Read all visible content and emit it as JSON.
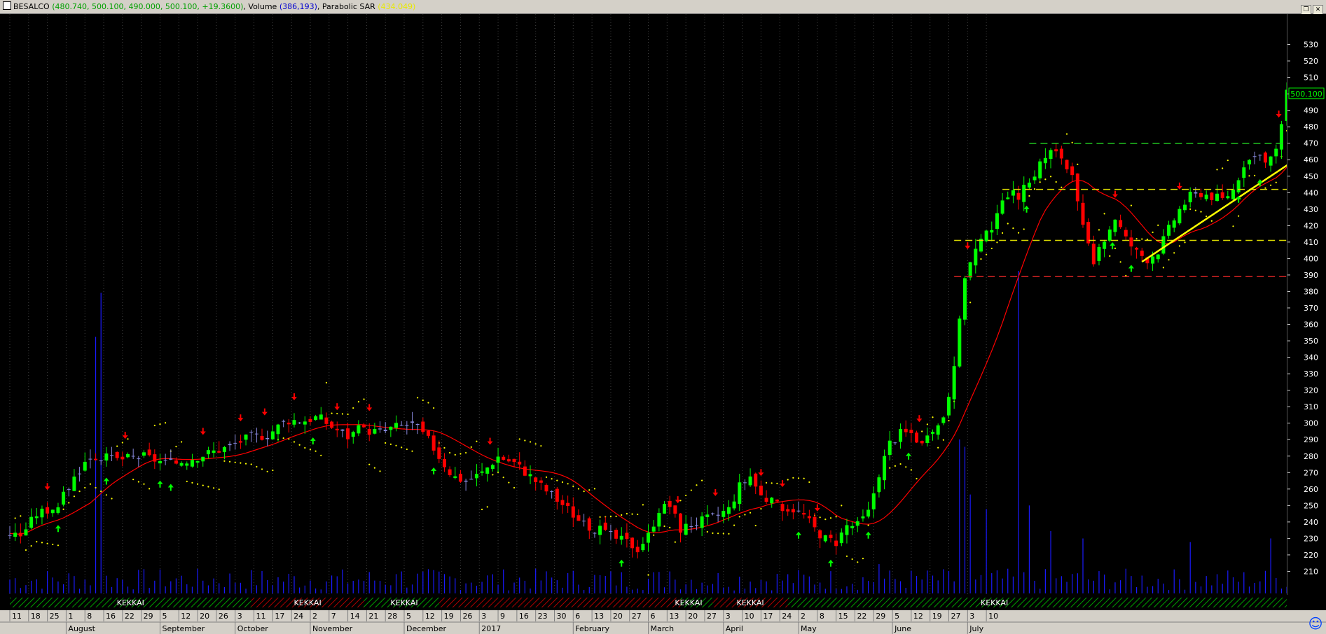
{
  "titlebar": {
    "symbol": "BESALCO",
    "ohlc": "(480.740, 500.100, 490.000, 500.100, +19.3600)",
    "volume_label": "Volume",
    "volume_value": "(386,193)",
    "sar_label": "Parabolic SAR",
    "sar_value": "(434.049)"
  },
  "price_tag": "500.100",
  "colors": {
    "background": "#000000",
    "up_candle": "#00ff00",
    "down_candle": "#ff0000",
    "doji_candle": "#8888dd",
    "ma_line": "#ff0000",
    "sar_dots": "#ffff00",
    "volume": "#1a1aff",
    "trendline": "#ffff00",
    "grid": "#404040"
  },
  "chart_data": {
    "type": "candlestick",
    "ylim": [
      200,
      540
    ],
    "yticks": [
      210,
      220,
      230,
      240,
      250,
      260,
      270,
      280,
      290,
      300,
      310,
      320,
      330,
      340,
      350,
      360,
      370,
      380,
      390,
      400,
      410,
      420,
      430,
      440,
      450,
      460,
      470,
      480,
      490,
      500,
      510,
      520,
      530
    ],
    "price_anchors": [
      [
        0,
        233
      ],
      [
        4,
        232
      ],
      [
        10,
        245
      ],
      [
        18,
        250
      ],
      [
        25,
        270
      ],
      [
        30,
        280
      ],
      [
        40,
        278
      ],
      [
        50,
        280
      ],
      [
        60,
        275
      ],
      [
        70,
        280
      ],
      [
        80,
        285
      ],
      [
        90,
        292
      ],
      [
        96,
        293
      ],
      [
        103,
        302
      ],
      [
        110,
        302
      ],
      [
        115,
        304
      ],
      [
        120,
        298
      ],
      [
        126,
        292
      ],
      [
        130,
        296
      ],
      [
        138,
        295
      ],
      [
        144,
        298
      ],
      [
        150,
        300
      ],
      [
        156,
        290
      ],
      [
        160,
        280
      ],
      [
        165,
        268
      ],
      [
        170,
        265
      ],
      [
        176,
        270
      ],
      [
        182,
        280
      ],
      [
        188,
        276
      ],
      [
        194,
        268
      ],
      [
        198,
        262
      ],
      [
        203,
        255
      ],
      [
        208,
        248
      ],
      [
        214,
        238
      ],
      [
        220,
        235
      ],
      [
        226,
        230
      ],
      [
        230,
        228
      ],
      [
        234,
        224
      ],
      [
        238,
        232
      ],
      [
        242,
        248
      ],
      [
        246,
        250
      ],
      [
        250,
        236
      ],
      [
        256,
        240
      ],
      [
        262,
        243
      ],
      [
        268,
        248
      ],
      [
        272,
        262
      ],
      [
        276,
        268
      ],
      [
        280,
        256
      ],
      [
        286,
        250
      ],
      [
        292,
        248
      ],
      [
        296,
        244
      ],
      [
        300,
        236
      ],
      [
        304,
        230
      ],
      [
        308,
        228
      ],
      [
        312,
        238
      ],
      [
        316,
        238
      ],
      [
        320,
        246
      ],
      [
        324,
        270
      ],
      [
        328,
        288
      ],
      [
        332,
        294
      ],
      [
        336,
        294
      ],
      [
        340,
        287
      ],
      [
        344,
        292
      ],
      [
        348,
        305
      ],
      [
        352,
        332
      ],
      [
        356,
        390
      ],
      [
        360,
        405
      ],
      [
        364,
        414
      ],
      [
        368,
        425
      ],
      [
        372,
        440
      ],
      [
        376,
        438
      ],
      [
        380,
        446
      ],
      [
        384,
        458
      ],
      [
        388,
        465
      ],
      [
        392,
        462
      ],
      [
        396,
        448
      ],
      [
        400,
        418
      ],
      [
        404,
        396
      ],
      [
        408,
        412
      ],
      [
        412,
        425
      ],
      [
        416,
        412
      ],
      [
        420,
        404
      ],
      [
        424,
        400
      ],
      [
        428,
        405
      ],
      [
        432,
        418
      ],
      [
        436,
        430
      ],
      [
        440,
        438
      ],
      [
        444,
        440
      ],
      [
        448,
        438
      ],
      [
        452,
        436
      ],
      [
        456,
        442
      ],
      [
        460,
        458
      ],
      [
        464,
        462
      ],
      [
        468,
        458
      ],
      [
        472,
        465
      ],
      [
        476,
        500
      ]
    ],
    "volume": {
      "ylim": [
        0,
        420
      ],
      "spikes": [
        [
          32,
          350
        ],
        [
          34,
          410
        ],
        [
          123,
          50
        ],
        [
          146,
          30
        ],
        [
          161,
          24
        ],
        [
          179,
          22
        ],
        [
          246,
          30
        ],
        [
          287,
          26
        ],
        [
          324,
          40
        ],
        [
          354,
          210
        ],
        [
          356,
          200
        ],
        [
          358,
          135
        ],
        [
          364,
          115
        ],
        [
          376,
          440
        ],
        [
          380,
          120
        ],
        [
          388,
          85
        ],
        [
          400,
          75
        ],
        [
          440,
          70
        ],
        [
          470,
          75
        ]
      ]
    },
    "trendline": {
      "x": [
        422,
        493
      ],
      "y": [
        398,
        475
      ]
    },
    "levels": [
      {
        "y": 470,
        "x": [
          380,
          480
        ],
        "color": "#22cc22"
      },
      {
        "y": 442,
        "x": [
          370,
          480
        ],
        "color": "#dddd00"
      },
      {
        "y": 411,
        "x": [
          352,
          480
        ],
        "color": "#dddd00"
      },
      {
        "y": 389,
        "x": [
          352,
          480
        ],
        "color": "#cc2222"
      }
    ],
    "buy_arrows": [
      18,
      36,
      56,
      60,
      113,
      158,
      228,
      294,
      306,
      320,
      335,
      379,
      411,
      418,
      458,
      466
    ],
    "sell_arrows": [
      14,
      43,
      72,
      86,
      95,
      106,
      122,
      134,
      179,
      249,
      263,
      280,
      288,
      301,
      339,
      357,
      412,
      436,
      473
    ],
    "x_labels": [
      {
        "d": 0,
        "t": "11"
      },
      {
        "d": 7,
        "t": "18"
      },
      {
        "d": 14,
        "t": "25"
      },
      {
        "d": 21,
        "t": "1"
      },
      {
        "d": 28,
        "t": "8"
      },
      {
        "d": 35,
        "t": "16"
      },
      {
        "d": 42,
        "t": "22"
      },
      {
        "d": 49,
        "t": "29"
      },
      {
        "d": 56,
        "t": "5"
      },
      {
        "d": 63,
        "t": "12"
      },
      {
        "d": 70,
        "t": "20"
      },
      {
        "d": 77,
        "t": "26"
      },
      {
        "d": 84,
        "t": "3"
      },
      {
        "d": 91,
        "t": "11"
      },
      {
        "d": 98,
        "t": "17"
      },
      {
        "d": 105,
        "t": "24"
      },
      {
        "d": 112,
        "t": "2"
      },
      {
        "d": 119,
        "t": "7"
      },
      {
        "d": 126,
        "t": "14"
      },
      {
        "d": 133,
        "t": "21"
      },
      {
        "d": 140,
        "t": "28"
      },
      {
        "d": 147,
        "t": "5"
      },
      {
        "d": 154,
        "t": "12"
      },
      {
        "d": 161,
        "t": "19"
      },
      {
        "d": 168,
        "t": "26"
      },
      {
        "d": 175,
        "t": "3"
      },
      {
        "d": 182,
        "t": "9"
      },
      {
        "d": 189,
        "t": "16"
      },
      {
        "d": 196,
        "t": "23"
      },
      {
        "d": 203,
        "t": "30"
      },
      {
        "d": 210,
        "t": "6"
      },
      {
        "d": 217,
        "t": "13"
      },
      {
        "d": 224,
        "t": "20"
      },
      {
        "d": 231,
        "t": "27"
      },
      {
        "d": 238,
        "t": "6"
      },
      {
        "d": 245,
        "t": "13"
      },
      {
        "d": 252,
        "t": "20"
      },
      {
        "d": 259,
        "t": "27"
      },
      {
        "d": 266,
        "t": "3"
      },
      {
        "d": 273,
        "t": "10"
      },
      {
        "d": 280,
        "t": "17"
      },
      {
        "d": 287,
        "t": "24"
      },
      {
        "d": 294,
        "t": "2"
      },
      {
        "d": 301,
        "t": "8"
      },
      {
        "d": 308,
        "t": "15"
      },
      {
        "d": 315,
        "t": "22"
      },
      {
        "d": 322,
        "t": "29"
      },
      {
        "d": 329,
        "t": "5"
      },
      {
        "d": 336,
        "t": "12"
      },
      {
        "d": 343,
        "t": "19"
      },
      {
        "d": 350,
        "t": "27"
      },
      {
        "d": 357,
        "t": "3"
      },
      {
        "d": 364,
        "t": "10"
      }
    ],
    "month_labels": [
      {
        "d": 21,
        "t": "August"
      },
      {
        "d": 56,
        "t": "September"
      },
      {
        "d": 84,
        "t": "October"
      },
      {
        "d": 112,
        "t": "November"
      },
      {
        "d": 147,
        "t": "December"
      },
      {
        "d": 175,
        "t": "2017"
      },
      {
        "d": 210,
        "t": "February"
      },
      {
        "d": 238,
        "t": "March"
      },
      {
        "d": 266,
        "t": "April"
      },
      {
        "d": 294,
        "t": "May"
      },
      {
        "d": 329,
        "t": "June"
      },
      {
        "d": 357,
        "t": "July"
      }
    ],
    "kekkai_band": {
      "label": "KEKKAI",
      "segments": [
        {
          "x": [
            0,
            90
          ],
          "color": "green"
        },
        {
          "x": [
            90,
            132
          ],
          "color": "red"
        },
        {
          "x": [
            132,
            160
          ],
          "color": "green"
        },
        {
          "x": [
            160,
            250
          ],
          "color": "red"
        },
        {
          "x": [
            250,
            262
          ],
          "color": "green"
        },
        {
          "x": [
            262,
            290
          ],
          "color": "red"
        },
        {
          "x": [
            290,
            480
          ],
          "color": "green"
        }
      ],
      "label_positions": [
        45,
        111,
        147,
        253,
        276,
        367
      ]
    }
  }
}
